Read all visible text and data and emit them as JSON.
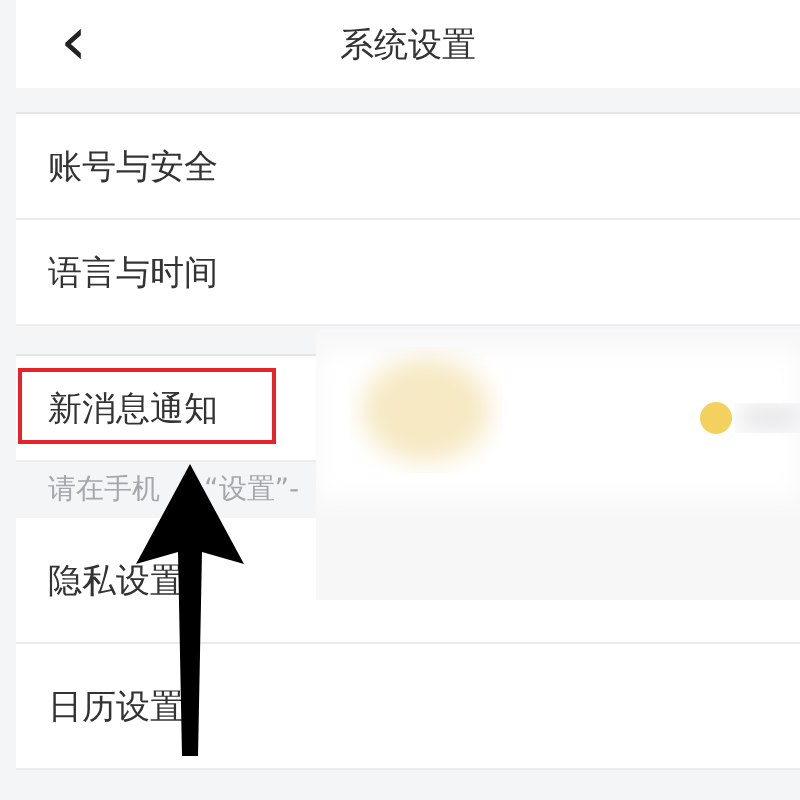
{
  "header": {
    "back_icon": "‹",
    "title": "系统设置"
  },
  "sections": [
    {
      "items": [
        {
          "kind": "item",
          "label": "账号与安全",
          "highlighted": false
        },
        {
          "kind": "item",
          "label": "语言与时间",
          "highlighted": false
        }
      ]
    },
    {
      "items": [
        {
          "kind": "item",
          "label": "新消息通知",
          "highlighted": true
        },
        {
          "kind": "hint",
          "parts": [
            "请在手机",
            "“设置”-"
          ]
        },
        {
          "kind": "item",
          "label": "隐私设置",
          "highlighted": false
        },
        {
          "kind": "item",
          "label": "日历设置",
          "highlighted": false
        }
      ]
    }
  ]
}
